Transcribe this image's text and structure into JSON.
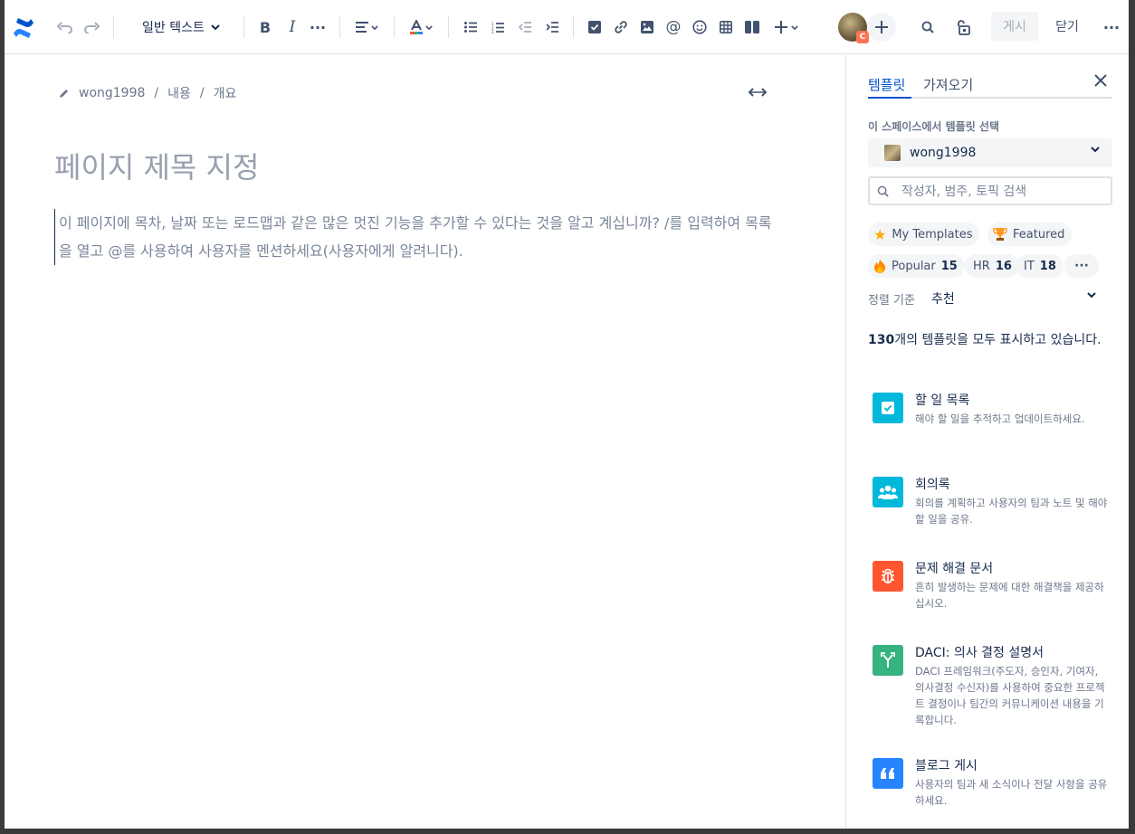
{
  "toolbar": {
    "undo_icon": "undo-icon",
    "redo_icon": "redo-icon",
    "text_style": "일반 텍스트",
    "publish_label": "게시",
    "close_label": "닫기",
    "avatar_badge": "C"
  },
  "editor": {
    "breadcrumb": [
      "wong1998",
      "내용",
      "개요"
    ],
    "title_placeholder": "페이지 제목 지정",
    "body_placeholder": "이 페이지에 목차, 날짜 또는 로드맵과 같은 많은 멋진 기능을 추가할 수 있다는 것을 알고 계십니까? /를 입력하여 목록을 열고 @를 사용하여 사용자를 멘션하세요(사용자에게 알려니다)."
  },
  "sidebar": {
    "tabs": [
      "템플릿",
      "가져오기"
    ],
    "space_label": "이 스페이스에서 템플릿 선택",
    "space_name": "wong1998",
    "search_placeholder": "작성자, 범주, 토픽 검색",
    "chips": [
      {
        "label": "My Templates",
        "count": ""
      },
      {
        "label": "Featured",
        "count": ""
      },
      {
        "label": "Popular",
        "count": "15"
      },
      {
        "label": "HR",
        "count": "16"
      },
      {
        "label": "IT",
        "count": "18"
      }
    ],
    "sort_label": "정렬 기준",
    "sort_value": "추천",
    "count_number": "130",
    "count_text": "개의 템플릿을 모두 표시하고 있습니다.",
    "templates": [
      {
        "title": "할 일 목록",
        "desc": "해야 할 일을 추적하고 업데이트하세요.",
        "color": "#00b8d9"
      },
      {
        "title": "회의록",
        "desc": "회의를 계획하고 사용자의 팀과 노트 및 해야할 일을 공유.",
        "color": "#00b8d9"
      },
      {
        "title": "문제 해결 문서",
        "desc": "흔히 발생하는 문제에 대한 해결책을 제공하십시오.",
        "color": "#ff5630"
      },
      {
        "title": "DACI: 의사 결정 설명서",
        "desc": "DACI 프레임워크(주도자, 승인자, 기여자, 의사결정 수신자)를 사용하여 중요한 프로젝트 결정이나 팀간의 커뮤니케이션 내용을 기록합니다.",
        "color": "#36b37e"
      },
      {
        "title": "블로그 게시",
        "desc": "사용자의 팀과 새 소식이나 전달 사항을 공유하세요.",
        "color": "#2684ff"
      }
    ]
  }
}
